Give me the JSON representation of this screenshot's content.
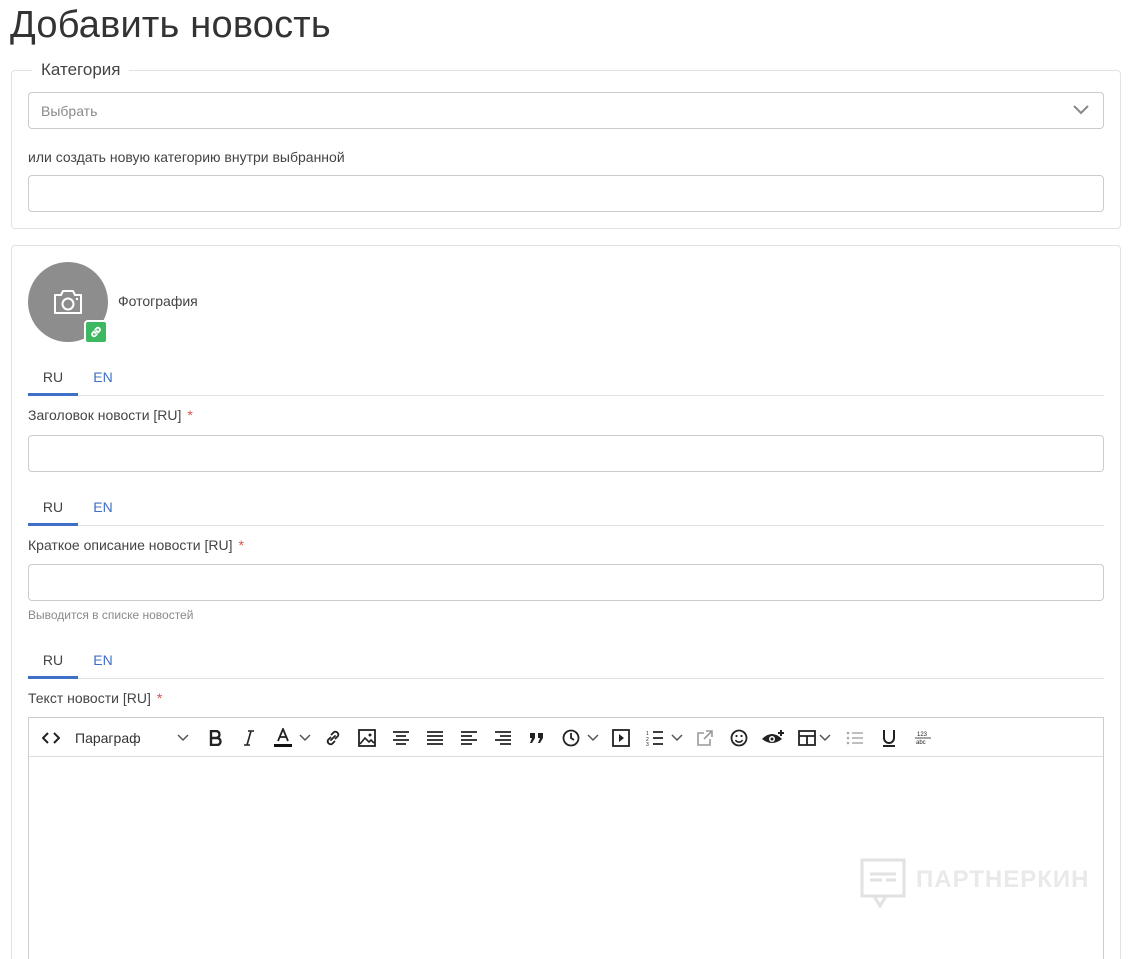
{
  "page": {
    "title": "Добавить новость"
  },
  "category": {
    "legend": "Категория",
    "select_value": "Выбрать",
    "new_category_label": "или создать новую категорию внутри выбранной",
    "new_category_value": ""
  },
  "photo": {
    "label": "Фотография",
    "icon": "camera-icon",
    "badge_icon": "link-icon"
  },
  "lang_tabs": [
    "RU",
    "EN"
  ],
  "fields": {
    "title": {
      "label": "Заголовок новости [RU]",
      "required_mark": "*",
      "value": ""
    },
    "summary": {
      "label": "Краткое описание новости [RU]",
      "required_mark": "*",
      "value": "",
      "help": "Выводится в списке новостей"
    },
    "body": {
      "label": "Текст новости [RU]",
      "required_mark": "*"
    }
  },
  "editor": {
    "paragraph_format": "Параграф",
    "toolbar_icons": [
      "source-code-icon",
      "bold-icon",
      "italic-icon",
      "font-color-icon",
      "link-icon",
      "image-icon",
      "align-center-icon",
      "align-justify-icon",
      "align-left-icon",
      "align-right-icon",
      "blockquote-icon",
      "clock-icon",
      "media-icon",
      "numbered-list-icon",
      "external-link-icon",
      "emoji-icon",
      "eye-icon",
      "table-icon",
      "bullet-list-icon",
      "underline-icon",
      "spellcheck-icon"
    ]
  },
  "watermark": {
    "text": "ПАРТНЕРКИН"
  },
  "colors": {
    "accent": "#3f6fc6",
    "required": "#d9534f",
    "badge": "#3cb860",
    "avatar_bg": "#8d8d8d"
  }
}
